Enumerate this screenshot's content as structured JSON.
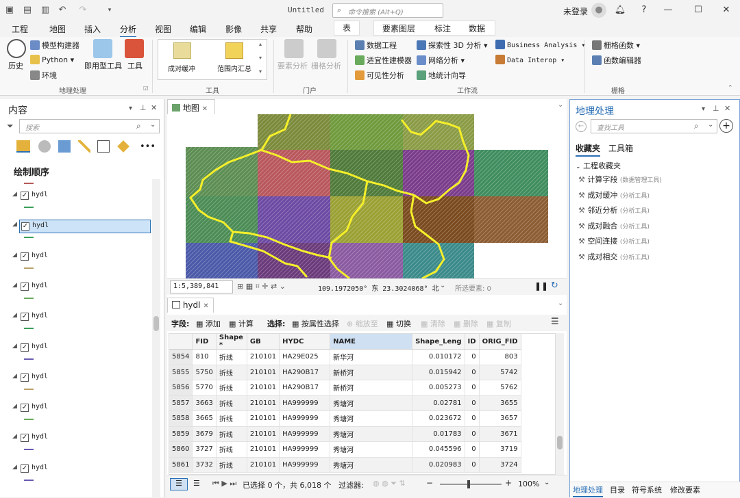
{
  "window": {
    "title": "Untitled",
    "command_search_placeholder": "命令搜索 (Alt+Q)",
    "user": "未登录"
  },
  "menu_tabs": [
    "工程",
    "地图",
    "插入",
    "分析",
    "视图",
    "编辑",
    "影像",
    "共享",
    "帮助"
  ],
  "active_tab": "分析",
  "contextual": {
    "table": "表",
    "feature_layer": "要素图层",
    "label": "标注",
    "data": "数据"
  },
  "ribbon": {
    "geoprocessing": {
      "history": "历史",
      "model_builder": "模型构建器",
      "python": "Python",
      "ready_tools": "即用型工具",
      "environments": "环境",
      "tools": "工具",
      "label": "地理处理"
    },
    "tools_gallery": {
      "items": [
        "成对缓冲",
        "范围内汇总"
      ],
      "label": "工具"
    },
    "portal": {
      "feature_analysis": "要素分析",
      "raster_analysis": "栅格分析",
      "label": "门户"
    },
    "workflows": {
      "data_engineering": "数据工程",
      "suitability": "适宜性建模器",
      "visibility": "可见性分析",
      "exploratory_3d": "探索性 3D 分析",
      "network": "网络分析",
      "geostat_wizard": "地统计向导",
      "business_analysis": "Business Analysis",
      "data_interop": "Data Interop",
      "label": "工作流"
    },
    "raster": {
      "raster_functions": "栅格函数",
      "function_editor": "函数编辑器",
      "label": "栅格"
    }
  },
  "contents": {
    "title": "内容",
    "search_placeholder": "搜索",
    "draw_order": "绘制顺序",
    "layer_name": "hydl",
    "layer_count": 10
  },
  "map": {
    "tab": "地图",
    "scale": "1:5,389,841",
    "coords": "109.1972050° 东 23.3024068° 北",
    "selected_features": "所选要素: 0"
  },
  "table": {
    "tab": "hydl",
    "toolbar": {
      "field": "字段:",
      "add": "添加",
      "calculate": "计算",
      "selection": "选择:",
      "by_attribute": "按属性选择",
      "zoom_to": "缩放至",
      "switch": "切换",
      "clear": "清除",
      "delete": "删除",
      "copy": "复制"
    },
    "columns": [
      "",
      "FID",
      "Shape *",
      "GB",
      "HYDC",
      "NAME",
      "Shape_Leng",
      "ID",
      "ORIG_FID"
    ],
    "rows": [
      [
        "5854",
        "810",
        "折线",
        "210101",
        "HA29E025",
        "新华河",
        "0.010172",
        "0",
        "803"
      ],
      [
        "5855",
        "5750",
        "折线",
        "210101",
        "HA290B17",
        "新桥河",
        "0.015942",
        "0",
        "5742"
      ],
      [
        "5856",
        "5770",
        "折线",
        "210101",
        "HA290B17",
        "新桥河",
        "0.005273",
        "0",
        "5762"
      ],
      [
        "5857",
        "3663",
        "折线",
        "210101",
        "HA999999",
        "秀塘河",
        "0.02781",
        "0",
        "3655"
      ],
      [
        "5858",
        "3665",
        "折线",
        "210101",
        "HA999999",
        "秀塘河",
        "0.023672",
        "0",
        "3657"
      ],
      [
        "5859",
        "3679",
        "折线",
        "210101",
        "HA999999",
        "秀塘河",
        "0.01783",
        "0",
        "3671"
      ],
      [
        "5860",
        "3727",
        "折线",
        "210101",
        "HA999999",
        "秀塘河",
        "0.045596",
        "0",
        "3719"
      ],
      [
        "5861",
        "3732",
        "折线",
        "210101",
        "HA999999",
        "秀塘河",
        "0.020983",
        "0",
        "3724"
      ]
    ],
    "status": "已选择 0 个，共 6,018 个",
    "filter": "过滤器:",
    "zoom": "100%"
  },
  "gp": {
    "title": "地理处理",
    "search_placeholder": "查找工具",
    "tab_favorites": "收藏夹",
    "tab_toolboxes": "工具箱",
    "group": "工程收藏夹",
    "favorites": [
      {
        "name": "计算字段",
        "box": "(数据管理工具)"
      },
      {
        "name": "成对缓冲",
        "box": "(分析工具)"
      },
      {
        "name": "邻近分析",
        "box": "(分析工具)"
      },
      {
        "name": "成对融合",
        "box": "(分析工具)"
      },
      {
        "name": "空间连接",
        "box": "(分析工具)"
      },
      {
        "name": "成对相交",
        "box": "(分析工具)"
      }
    ],
    "bottom_tabs": [
      "地理处理",
      "目录",
      "符号系统",
      "修改要素"
    ]
  }
}
